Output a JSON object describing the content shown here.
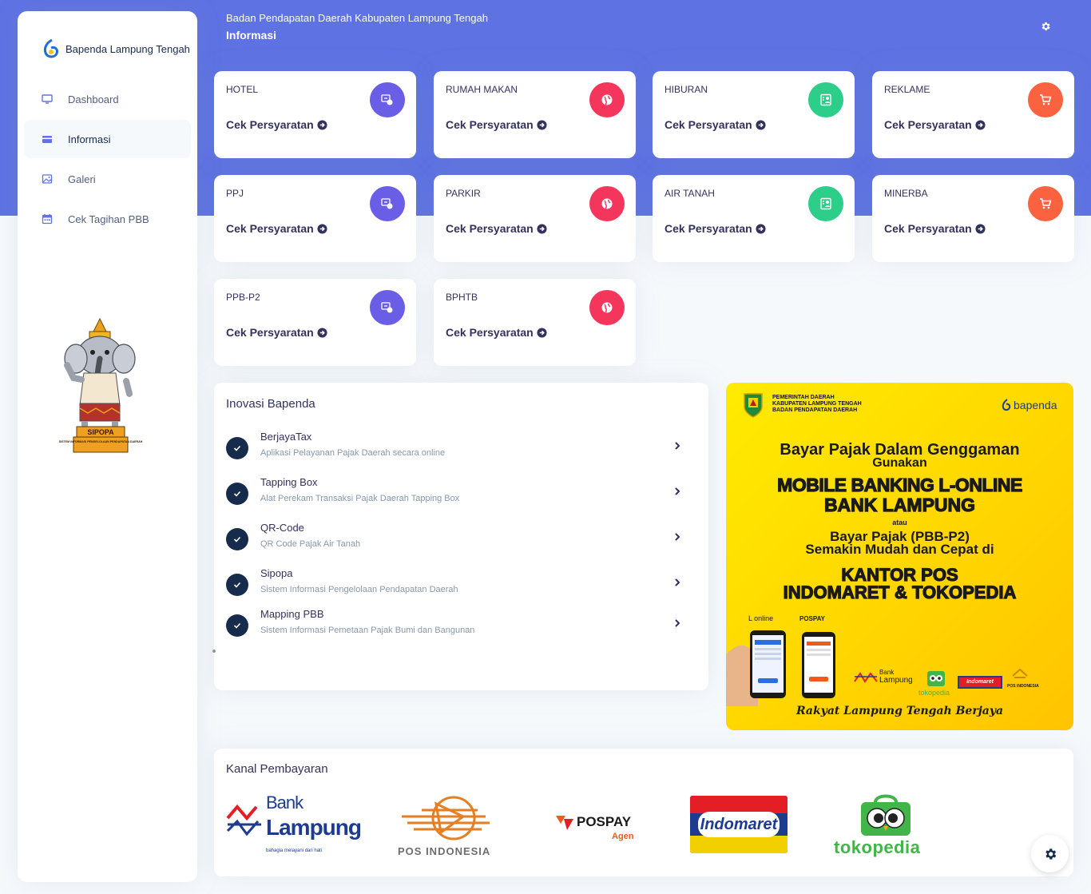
{
  "brand": {
    "name": "Bapenda Lampung Tengah"
  },
  "header": {
    "subtitle": "Badan Pendapatan Daerah Kabupaten Lampung Tengah",
    "title": "Informasi"
  },
  "sidebar": {
    "items": [
      {
        "label": "Dashboard",
        "icon": "monitor-icon",
        "active": false
      },
      {
        "label": "Informasi",
        "icon": "card-icon",
        "active": true
      },
      {
        "label": "Galeri",
        "icon": "image-icon",
        "active": false
      },
      {
        "label": "Cek Tagihan PBB",
        "icon": "calendar-icon",
        "active": false
      }
    ],
    "mascot": {
      "label": "SIPOPA",
      "caption": "SISTEM INFORMASI PENGELOLAAN PENDAPATAN DAERAH"
    }
  },
  "cards": [
    {
      "label": "HOTEL",
      "link": "Cek Persyaratan",
      "color": "#6b5ee6",
      "icon": "money-coins-icon"
    },
    {
      "label": "RUMAH MAKAN",
      "link": "Cek Persyaratan",
      "color": "#f5365c",
      "icon": "globe-icon"
    },
    {
      "label": "HIBURAN",
      "link": "Cek Persyaratan",
      "color": "#2dce89",
      "icon": "badge-icon"
    },
    {
      "label": "REKLAME",
      "link": "Cek Persyaratan",
      "color": "#fb6340",
      "icon": "cart-icon"
    },
    {
      "label": "PPJ",
      "link": "Cek Persyaratan",
      "color": "#6b5ee6",
      "icon": "money-coins-icon"
    },
    {
      "label": "PARKIR",
      "link": "Cek Persyaratan",
      "color": "#f5365c",
      "icon": "globe-icon"
    },
    {
      "label": "AIR TANAH",
      "link": "Cek Persyaratan",
      "color": "#2dce89",
      "icon": "badge-icon"
    },
    {
      "label": "MINERBA",
      "link": "Cek Persyaratan",
      "color": "#fb6340",
      "icon": "cart-icon"
    },
    {
      "label": "PPB-P2",
      "link": "Cek Persyaratan",
      "color": "#6b5ee6",
      "icon": "money-coins-icon"
    },
    {
      "label": "BPHTB",
      "link": "Cek Persyaratan",
      "color": "#f5365c",
      "icon": "globe-icon"
    }
  ],
  "inovasi": {
    "title": "Inovasi Bapenda",
    "items": [
      {
        "name": "BerjayaTax",
        "desc": "Aplikasi Pelayanan Pajak Daerah secara online"
      },
      {
        "name": "Tapping Box",
        "desc": "Alat Perekam Transaksi Pajak Daerah Tapping Box"
      },
      {
        "name": "QR-Code",
        "desc": "QR Code Pajak Air Tanah"
      },
      {
        "name": "Sipopa",
        "desc": "Sistem Informasi Pengelolaan Pendapatan Daerah"
      },
      {
        "name": "Mapping PBB",
        "desc": "Sistem Informasi Pemetaan Pajak Bumi dan Bangunan"
      }
    ]
  },
  "banner": {
    "org": [
      "PEMERINTAH DAERAH",
      "KABUPATEN LAMPUNG TENGAH",
      "BADAN PENDAPATAN DAERAH"
    ],
    "brand": "bapenda",
    "line1": "Bayar Pajak Dalam Genggaman",
    "line2": "Gunakan",
    "line3": "MOBILE BANKING L-ONLINE",
    "line4": "BANK LAMPUNG",
    "atau": "atau",
    "line5": "Bayar Pajak (PBB-P2)",
    "line6": "Semakin Mudah dan Cepat di",
    "line7": "KANTOR POS",
    "line8": "INDOMARET & TOKOPEDIA",
    "lonline": "L online",
    "pospay": "POSPAY",
    "bank_small": "Bank",
    "bank_big": "Lampung",
    "toko": "tokopedia",
    "indo": "Indomaret",
    "pos": "POS INDONESIA",
    "slogan": "Rakyat Lampung Tengah Berjaya"
  },
  "kanal": {
    "title": "Kanal Pembayaran",
    "logos": {
      "bank_lampung": {
        "top": "Bank",
        "main": "Lampung",
        "tag": "bahagia melayani dari hati"
      },
      "pos": "POS INDONESIA",
      "pospay": {
        "main": "POSPAY",
        "sub": "Agen"
      },
      "indomaret": "Indomaret",
      "tokopedia": "tokopedia"
    }
  },
  "colors": {
    "primary": "#5e72e4",
    "dark": "#172b4d",
    "text": "#32325d",
    "muted": "#8898aa"
  }
}
